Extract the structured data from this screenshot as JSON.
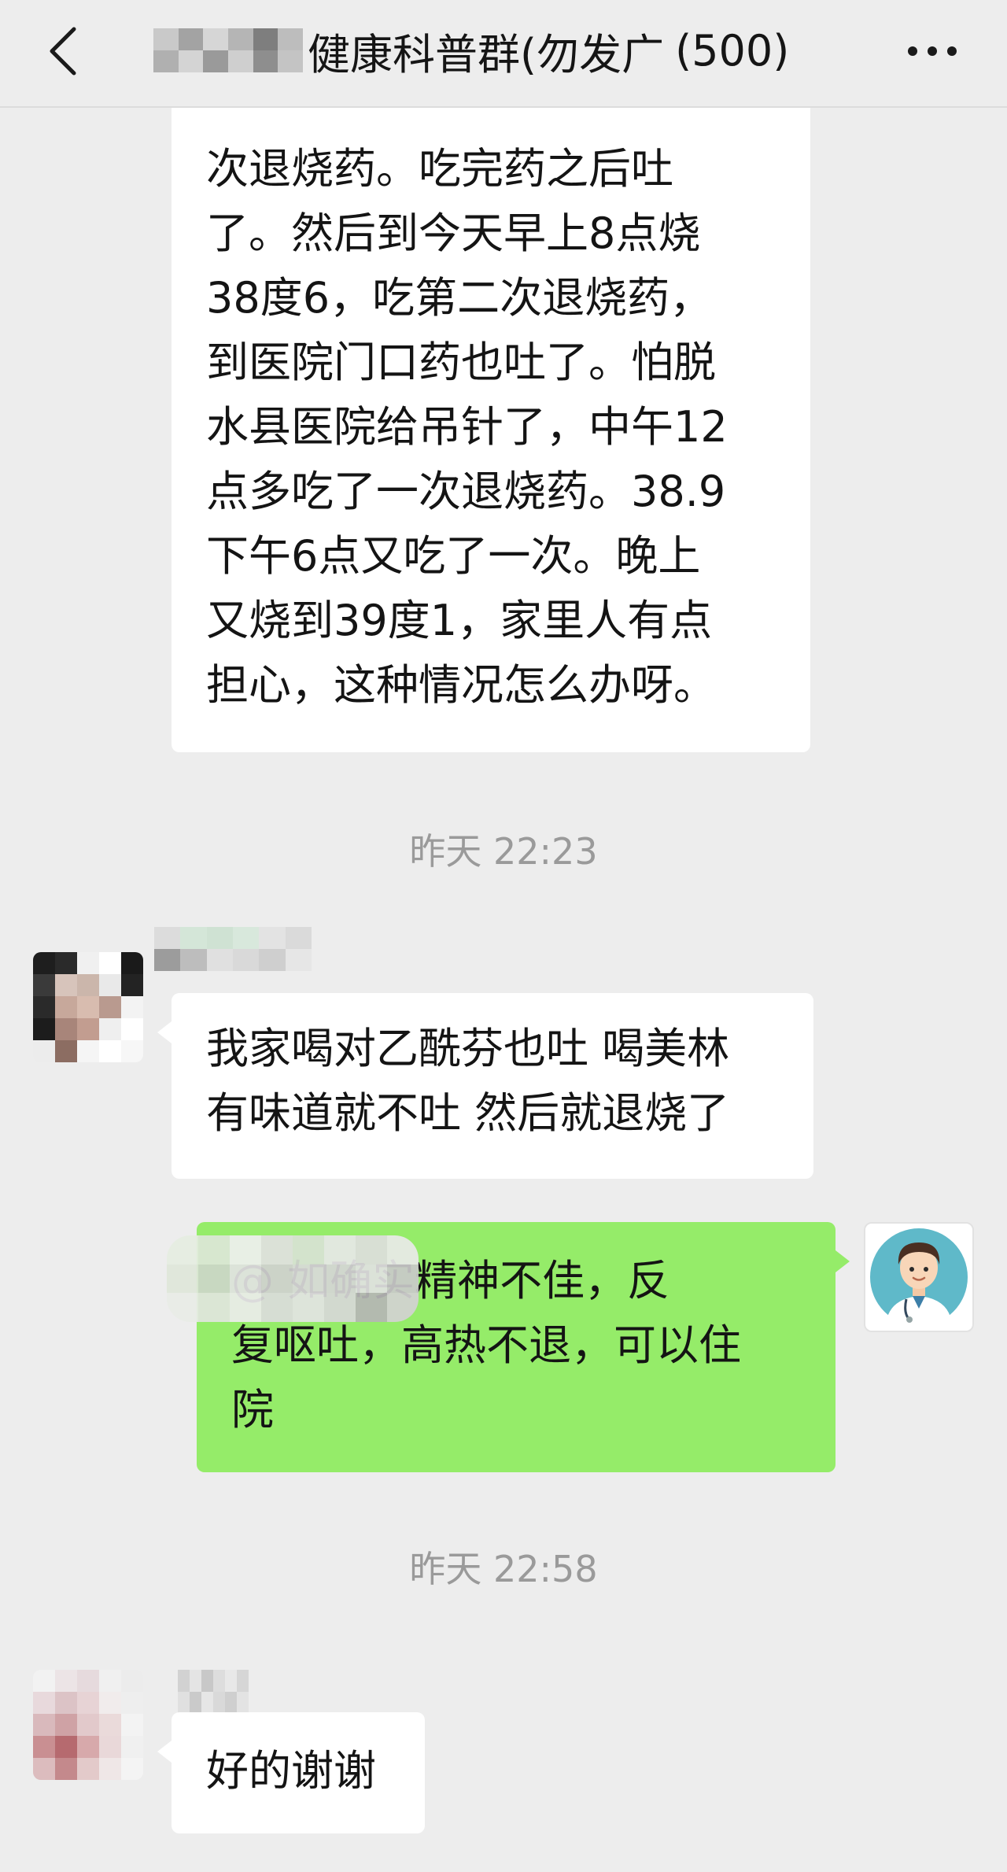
{
  "header": {
    "title": "健康科普群(勿发广",
    "member_count": "(500)",
    "back_icon": "chevron-left-icon",
    "more_icon": "more-dots-icon"
  },
  "messages": {
    "msg1": {
      "lines": [
        "次退烧药。吃完药之后吐",
        "了。然后到今天早上8点烧",
        "38度6，吃第二次退烧药，",
        "到医院门口药也吐了。怕脱",
        "水县医院给吊针了，中午12",
        "点多吃了一次退烧药。38.9",
        "下午6点又吃了一次。晚上",
        "又烧到39度1，家里人有点",
        "担心，这种情况怎么办呀。"
      ]
    },
    "ts1": "昨天 22:23",
    "msg2": {
      "lines": [
        "我家喝对乙酰芬也吐 喝美林",
        "有味道就不吐 然后就退烧了"
      ]
    },
    "msg3": {
      "lines": [
        "@          如确实精神不佳，反",
        "复呕吐，高热不退，可以住",
        "院"
      ]
    },
    "ts2": "昨天 22:58",
    "msg4": {
      "lines": [
        "好的谢谢"
      ]
    }
  },
  "colors": {
    "background": "#ededed",
    "bubble_other": "#ffffff",
    "bubble_self": "#95ec69",
    "timestamp": "#9a9a9a"
  }
}
